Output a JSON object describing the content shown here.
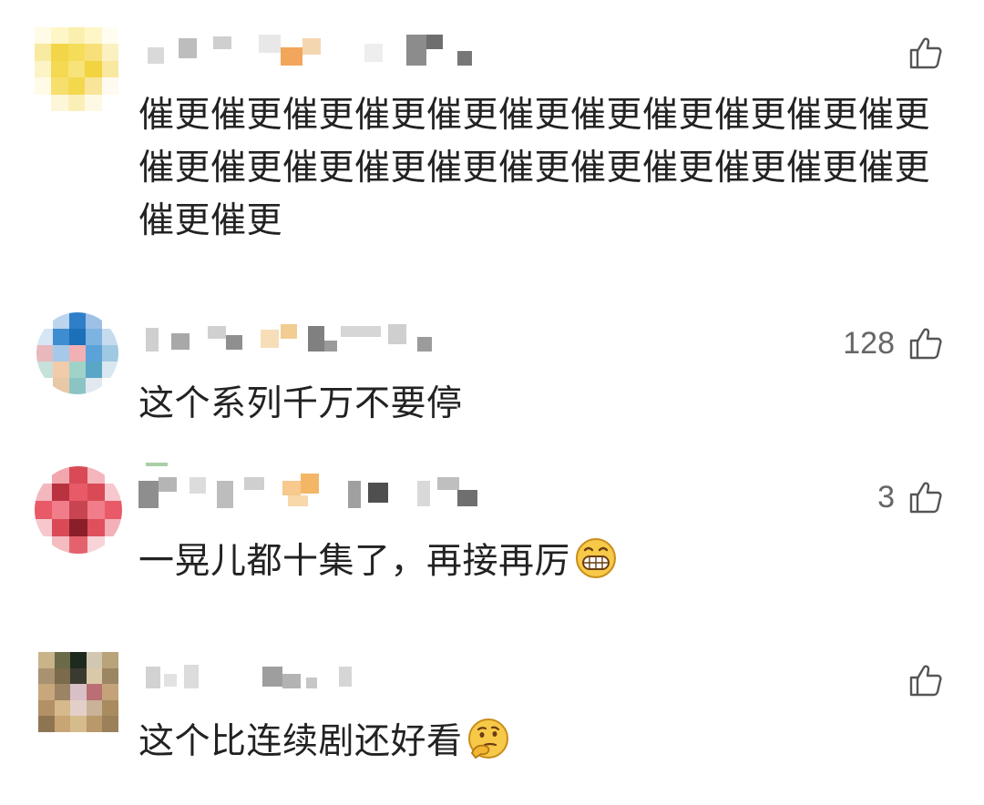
{
  "comments": [
    {
      "text": "催更催更催更催更催更催更催更催更催更催更催更催更催更催更催更催更催更催更催更催更催更催更催更催更",
      "likes": "",
      "avatar_colors": [
        "#fff6c8",
        "#f7e37a",
        "#f3d648",
        "#f7e07a",
        "#fff4cc"
      ],
      "emoji": ""
    },
    {
      "text": "这个系列千万不要停",
      "likes": "128",
      "avatar_colors": [
        "#8fb6e3",
        "#2e7fc7",
        "#f0b0b4",
        "#9fd3c8",
        "#e8c9a7"
      ],
      "emoji": ""
    },
    {
      "text": "一晃儿都十集了，再接再厉",
      "likes": "3",
      "avatar_colors": [
        "#d94a56",
        "#e85a68",
        "#b9323f",
        "#f07d89",
        "#c84450"
      ],
      "emoji": "grinning-face-emoji"
    },
    {
      "text": "这个比连续剧还好看",
      "likes": "",
      "avatar_colors": [
        "#c9b48a",
        "#7b6a4c",
        "#3a3a30",
        "#d9c9a8",
        "#a89270"
      ],
      "emoji": "thinking-face-emoji"
    }
  ],
  "icons": {
    "like": "thumbs-up-icon"
  }
}
